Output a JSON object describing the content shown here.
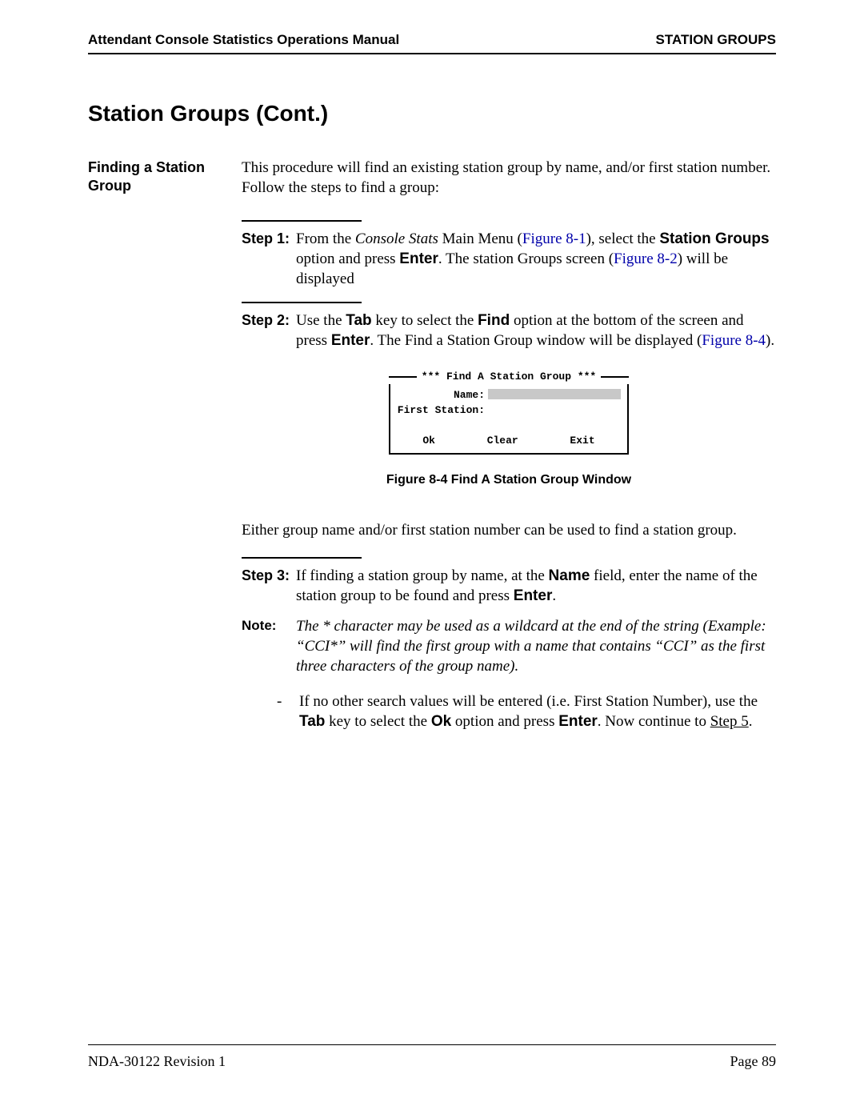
{
  "header": {
    "left": "Attendant Console Statistics Operations Manual",
    "right": "STATION GROUPS"
  },
  "section_title": "Station Groups (Cont.)",
  "side_heading_line1": "Finding a Station",
  "side_heading_line2": "Group",
  "intro": "This procedure will find an existing station group by name, and/or first station number. Follow the steps to find a group:",
  "step1": {
    "label": "Step 1:",
    "p1a": "From the ",
    "p1b_italic": "Console Stats",
    "p1c": " Main Menu (",
    "link1": "Figure 8-1",
    "p1d": "), select the ",
    "p1e_bold": "Station Groups",
    "p1f": " option and press ",
    "p1g_bold": "Enter",
    "p1h": ". The station Groups screen (",
    "link2": "Figure 8-2",
    "p1i": ") will be displayed"
  },
  "step2": {
    "label": "Step 2:",
    "p2a": "Use the ",
    "p2b_bold": "Tab",
    "p2c": " key to select the ",
    "p2d_bold": "Find",
    "p2e": " option at the bottom of the screen and press ",
    "p2f_bold": "Enter",
    "p2g": ". The Find a Station Group window will be displayed (",
    "link3": "Figure 8-4",
    "p2h": ")."
  },
  "figure": {
    "title": "*** Find A Station Group ***",
    "name_label": "Name:",
    "first_station_label": "First Station:",
    "ok": "Ok",
    "clear": "Clear",
    "exit": "Exit",
    "caption": "Figure 8-4   Find A Station Group Window"
  },
  "para_after_figure": "Either group name and/or first station number can be used to find a station group.",
  "step3": {
    "label": "Step 3:",
    "p3a": "If finding a station group by name, at the ",
    "p3b_bold": "Name",
    "p3c": " field, enter the name of the station group to be found and press ",
    "p3d_bold": "Enter",
    "p3e": "."
  },
  "note": {
    "label": "Note:",
    "body": "The * character may be used as a wildcard at the end of the string (Example: “CCI*” will find the first group with a name that contains “CCI” as the first three characters of the group name)."
  },
  "dash": {
    "marker": "-",
    "d1": "If no other search values will be entered (i.e. First Station Number), use the ",
    "d2_bold": "Tab",
    "d3": " key to select the ",
    "d4_bold": "Ok",
    "d5": " option and press ",
    "d6_bold": "Enter",
    "d7": ". Now continue to ",
    "d8_link": "Step 5",
    "d9": "."
  },
  "footer": {
    "left": "NDA-30122   Revision 1",
    "right": "Page 89"
  }
}
